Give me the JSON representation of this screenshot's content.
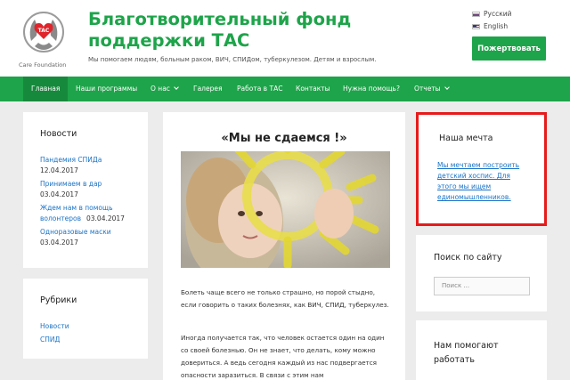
{
  "header": {
    "logo_caption": "Care Foundation",
    "logo_badge": "TAC",
    "title_line1": "Благотворительный фонд",
    "title_line2": "поддержки ТАС",
    "tagline": "Мы помогаем людям, больным раком, ВИЧ, СПИДом, туберкулезом. Детям и взрослым.",
    "languages": [
      {
        "label": "Русский",
        "flag": "ru"
      },
      {
        "label": "English",
        "flag": "en"
      }
    ],
    "donate_label": "Пожертвовать"
  },
  "nav": {
    "items": [
      {
        "label": "Главная",
        "active": true
      },
      {
        "label": "Наши программы"
      },
      {
        "label": "О нас",
        "dropdown": true
      },
      {
        "label": "Галерея"
      },
      {
        "label": "Работа в ТАС"
      },
      {
        "label": "Контакты"
      },
      {
        "label": "Нужна помощь?"
      },
      {
        "label": "Отчеты",
        "dropdown": true
      }
    ]
  },
  "sidebar_left": {
    "news_title": "Новости",
    "news": [
      {
        "title": "Пандемия СПИДа",
        "date": "12.04.2017"
      },
      {
        "title": "Принимаем в дар",
        "date": "03.04.2017"
      },
      {
        "title_line1": "Ждем нам в помощь",
        "title_line2": "волонтеров",
        "date": "03.04.2017"
      },
      {
        "title": "Одноразовые маски",
        "date": "03.04.2017"
      }
    ],
    "rubrics_title": "Рубрики",
    "rubrics": [
      "Новости",
      "СПИД"
    ]
  },
  "article": {
    "title": "«Мы не сдаемся !»",
    "paragraph1": "Болеть чаще всего не только страшно, но порой стыдно, если говорить о таких болезнях, как ВИЧ, СПИД, туберкулез.",
    "paragraph2": "Иногда получается так, что человек остается один на один со своей болезнью. Он не знает, что делать, кому можно довериться. А ведь сегодня каждый из нас подвергается опасности заразиться. В связи с этим нам"
  },
  "sidebar_right": {
    "dream_title": "Наша мечта",
    "dream_text": "Мы мечтаем построить детский хоспис. Для этого мы ищем единомышленников.",
    "search_title": "Поиск по сайту",
    "search_placeholder": "Поиск ...",
    "helpers_title_line1": "Нам помогают",
    "helpers_title_line2": "работать"
  },
  "colors": {
    "brand_green": "#1ea44a",
    "active_nav": "#17893c",
    "link_blue": "#1a73c7",
    "highlight_red": "#e61b1b"
  },
  "icons": {
    "logo": "heart-hands-logo",
    "dropdown": "chevron-down-icon"
  }
}
